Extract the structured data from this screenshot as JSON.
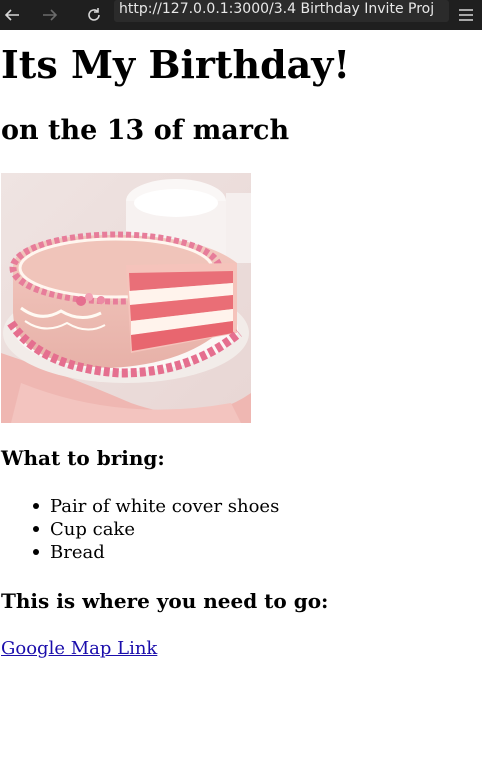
{
  "browser": {
    "url": "http://127.0.0.1:3000/3.4 Birthday Invite Proj"
  },
  "page": {
    "title": "Its My Birthday!",
    "subtitle": "on the 13 of march",
    "bring_heading": "What to bring:",
    "bring_items": [
      "Pair of white cover shoes",
      "Cup cake",
      "Bread"
    ],
    "go_heading": "This is where you need to go:",
    "map_link": "Google Map Link"
  },
  "icons": {
    "back": "arrow-left-icon",
    "forward": "arrow-right-icon",
    "reload": "reload-icon",
    "menu": "hamburger-menu-icon",
    "cake_image": "birthday-cake-image"
  }
}
